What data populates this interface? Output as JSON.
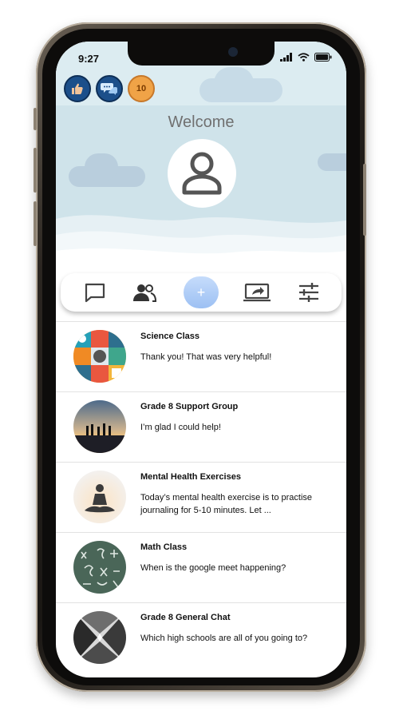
{
  "status_bar": {
    "time": "9:27"
  },
  "badges": [
    {
      "icon": "thumbs-up-icon"
    },
    {
      "icon": "chat-bubbles-icon"
    },
    {
      "icon": "ten-coin-icon",
      "text": "10"
    }
  ],
  "header": {
    "welcome": "Welcome"
  },
  "tabs": [
    {
      "icon": "chat-bubble-icon"
    },
    {
      "icon": "people-icon"
    },
    {
      "icon": "add-icon",
      "label": "+"
    },
    {
      "icon": "share-screen-icon"
    },
    {
      "icon": "sliders-icon"
    }
  ],
  "chats": [
    {
      "name": "Science Class",
      "message": "Thank you! That was very helpful!"
    },
    {
      "name": "Grade 8 Support Group",
      "message": "I’m glad I could help!"
    },
    {
      "name": "Mental Health Exercises",
      "message": "Today’s mental health exercise is to practise journaling for 5-10 minutes. Let ..."
    },
    {
      "name": "Math Class",
      "message": "When is the google meet happening?"
    },
    {
      "name": "Grade 8 General Chat",
      "message": "Which high schools are all of you going to?"
    }
  ],
  "colors": {
    "accent": "#9cc0f3",
    "hero_bg": "#cfe3ea",
    "badge_bg": "#1c4f8a"
  }
}
